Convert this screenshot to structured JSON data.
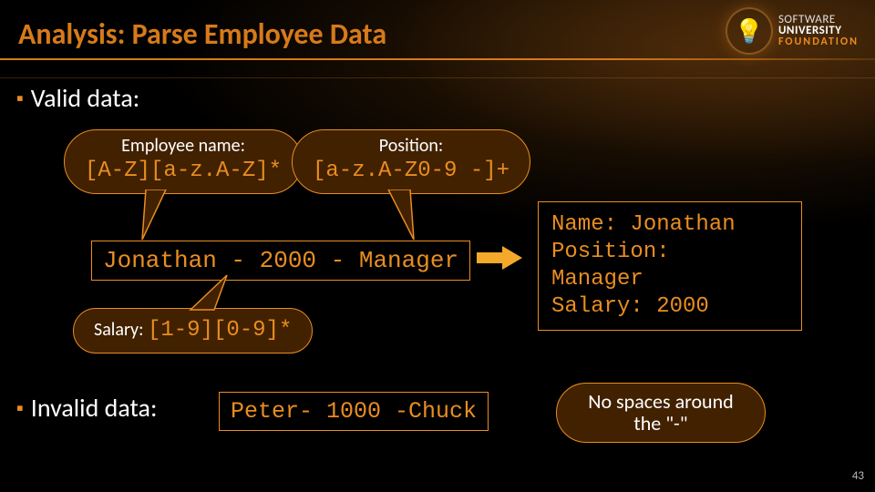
{
  "title": "Analysis: Parse Employee Data",
  "logo": {
    "line1": "SOFTWARE",
    "line2": "UNIVERSITY",
    "line3": "FOUNDATION",
    "glyph": "💡"
  },
  "bullets": {
    "valid": "Valid data:",
    "invalid": "Invalid data:"
  },
  "callouts": {
    "name": {
      "label": "Employee name:",
      "regex": "[A-Z][a-z.A-Z]*"
    },
    "position": {
      "label": "Position:",
      "regex": "[a-z.A-Z0-9 -]+"
    },
    "salary": {
      "label": "Salary:",
      "regex": "[1-9][0-9]*"
    }
  },
  "example_valid": "Jonathan - 2000 - Manager",
  "output": "Name: Jonathan\nPosition:\nManager\nSalary: 2000",
  "example_invalid": "Peter- 1000 -Chuck",
  "note": "No spaces around the \"-\"",
  "arrow_icon": "arrow-right-icon",
  "page_number": "43",
  "colors": {
    "accent": "#e98d20",
    "callout_bg": "#412100"
  }
}
